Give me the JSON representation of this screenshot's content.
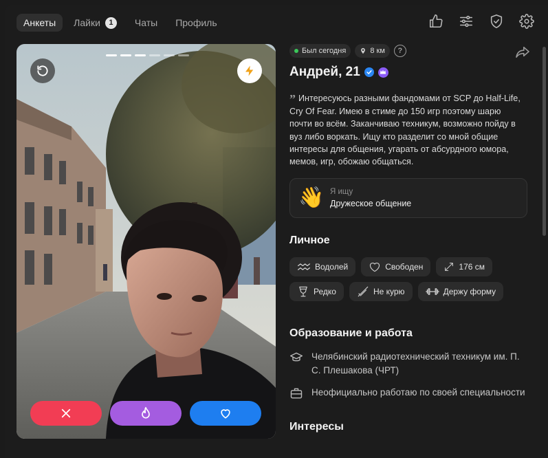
{
  "nav": {
    "tabs": [
      {
        "label": "Анкеты",
        "active": true
      },
      {
        "label": "Лайки",
        "badge": "1"
      },
      {
        "label": "Чаты"
      },
      {
        "label": "Профиль"
      }
    ],
    "icons": [
      "thumbs-up-icon",
      "filters-icon",
      "shield-check-icon",
      "gear-icon"
    ]
  },
  "photo": {
    "photo_count": 6,
    "current_photo": 3,
    "actions": [
      "close-icon",
      "fire-icon",
      "heart-icon"
    ]
  },
  "profile": {
    "status": "Был сегодня",
    "distance": "8 км",
    "help": "?",
    "name_age": "Андрей, 21",
    "bio": "Интересуюсь разными фандомами от SCP до Half-Life, Cry Of Fear. Имею в стиме до 150 игр поэтому шарю почти во всём. Заканчиваю техникум, возможно пойду в вуз либо воркать. Ищу кто разделит со мной общие интересы для общения, угарать от абсурдного юмора, мемов, игр, обожаю общаться.",
    "seeking": {
      "label": "Я ищу",
      "value": "Дружеское общение",
      "emoji": "👋"
    }
  },
  "personal": {
    "title": "Личное",
    "tags": [
      {
        "icon": "aquarius-icon",
        "label": "Водолей"
      },
      {
        "icon": "heart-outline-icon",
        "label": "Свободен"
      },
      {
        "icon": "height-icon",
        "label": "176 см"
      },
      {
        "icon": "glass-icon",
        "label": "Редко"
      },
      {
        "icon": "no-smoking-icon",
        "label": "Не курю"
      },
      {
        "icon": "dumbbell-icon",
        "label": "Держу форму"
      }
    ]
  },
  "education": {
    "title": "Образование и работа",
    "school": "Челябинский радиотехнический техникум им. П. С. Плешакова (ЧРТ)",
    "work": "Неофициально работаю по своей специальности"
  },
  "interests": {
    "title": "Интересы"
  },
  "colors": {
    "accent_red": "#f23d54",
    "accent_purple": "#a45ce0",
    "accent_blue": "#1e7ef0",
    "online": "#3bc75a"
  }
}
